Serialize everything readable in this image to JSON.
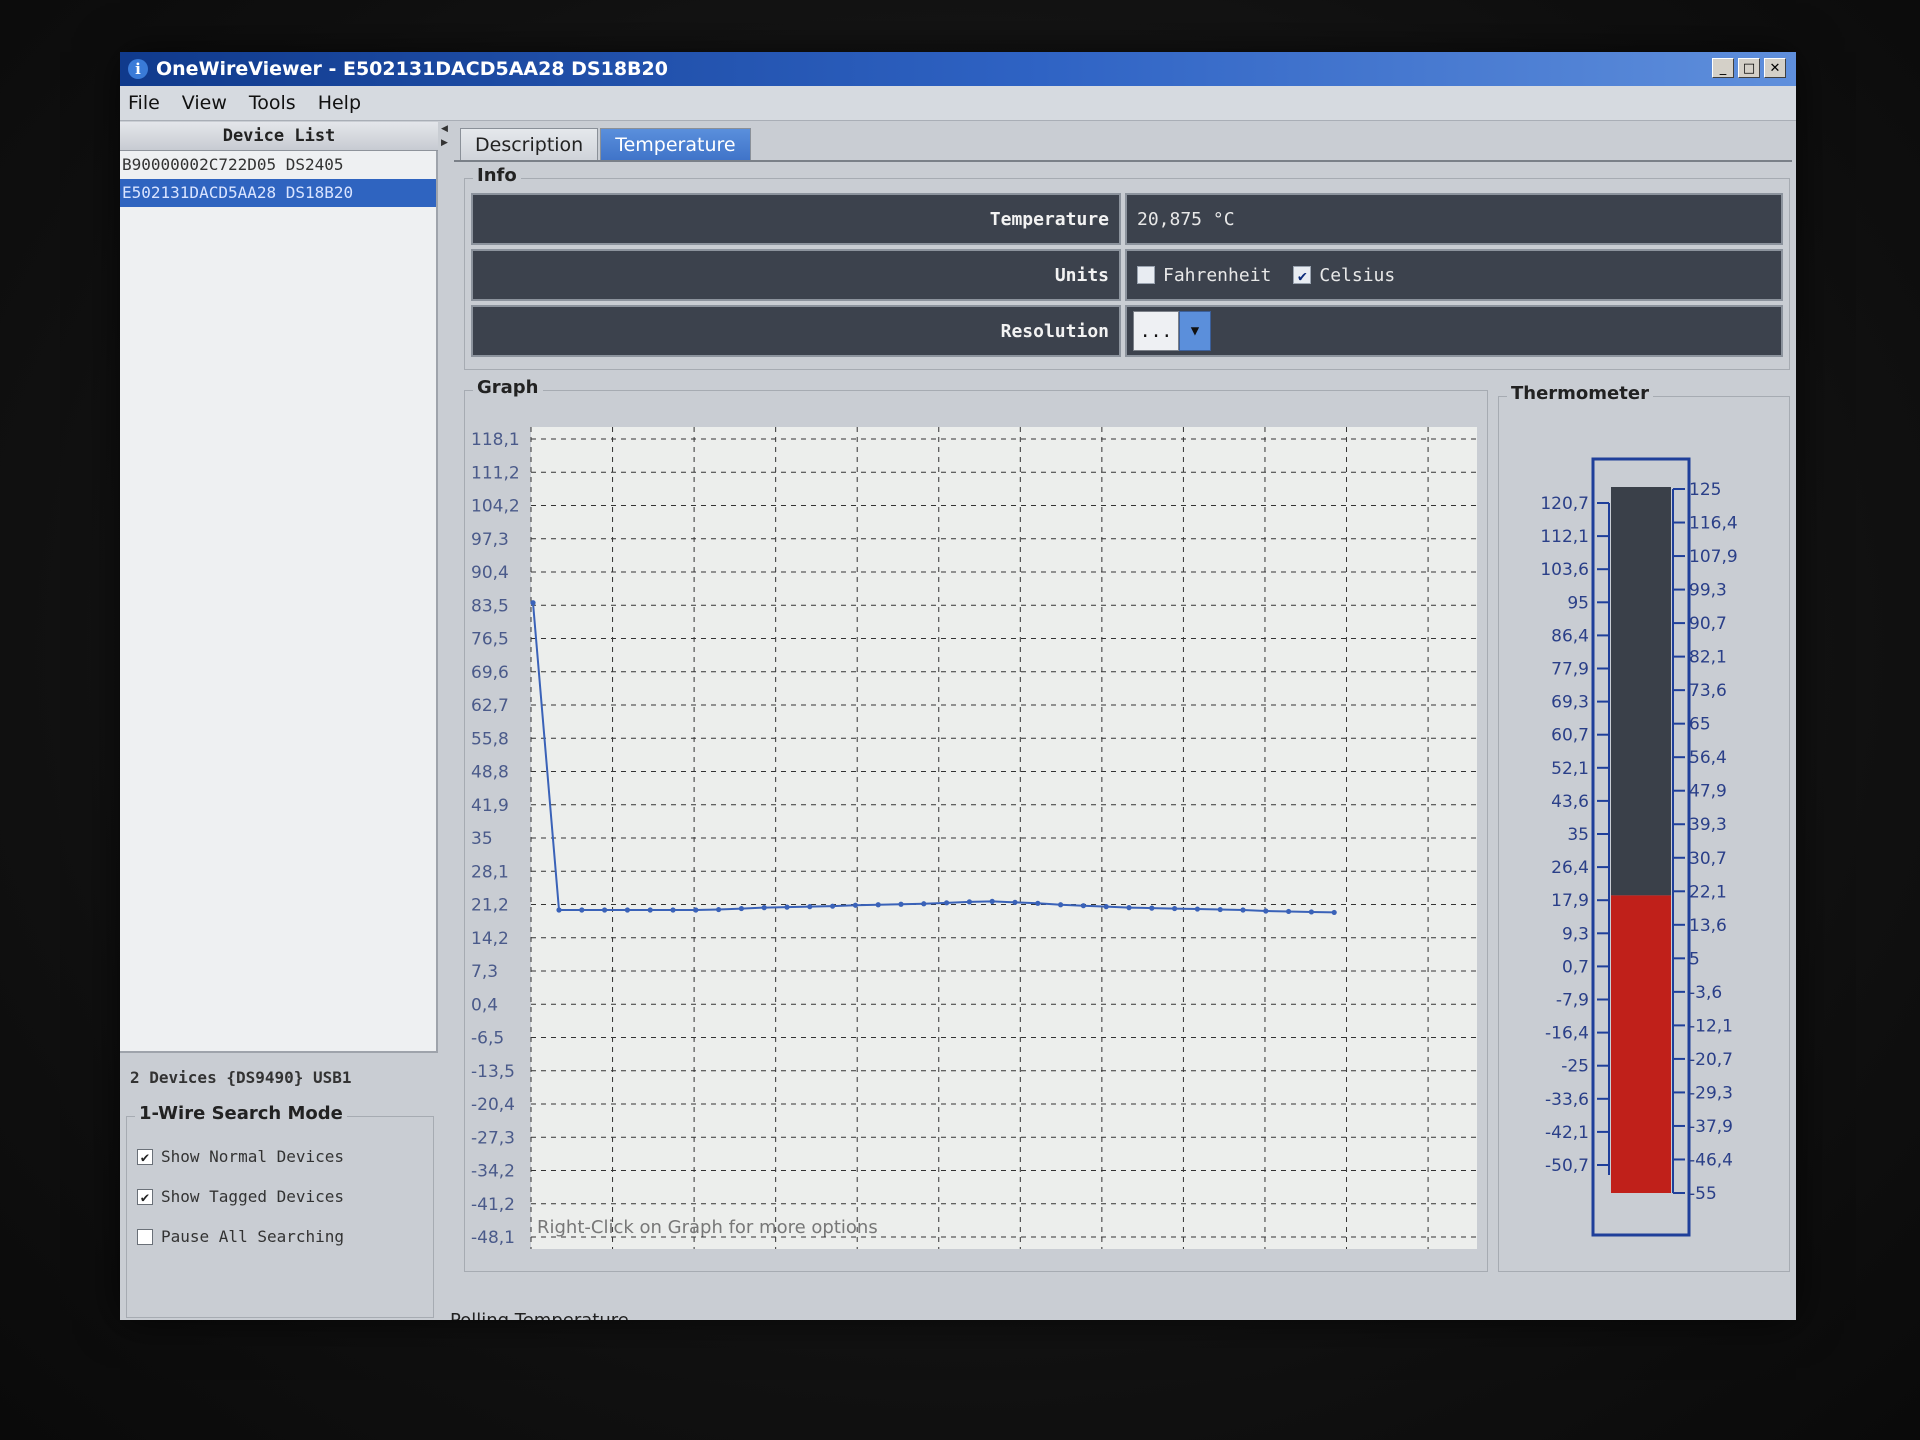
{
  "window": {
    "title": "OneWireViewer - E502131DACD5AA28 DS18B20",
    "title_icon": "i",
    "minimize": "_",
    "maximize": "□",
    "close": "✕"
  },
  "menu": [
    "File",
    "View",
    "Tools",
    "Help"
  ],
  "device_list": {
    "header": "Device List",
    "items": [
      {
        "label": "B90000002C722D05 DS2405",
        "selected": false
      },
      {
        "label": "E502131DACD5AA28 DS18B20",
        "selected": true
      }
    ],
    "adapter_info": "2 Devices  {DS9490} USB1"
  },
  "search_mode": {
    "legend": "1-Wire Search Mode",
    "options": [
      {
        "label": "Show Normal Devices",
        "checked": true
      },
      {
        "label": "Show Tagged Devices",
        "checked": true
      },
      {
        "label": "Pause All Searching",
        "checked": false
      }
    ]
  },
  "tabs": [
    {
      "label": "Description",
      "active": false
    },
    {
      "label": "Temperature",
      "active": true
    }
  ],
  "info": {
    "legend": "Info",
    "temperature_label": "Temperature",
    "temperature_value": "20,875 °C",
    "units_label": "Units",
    "fahrenheit_label": "Fahrenheit",
    "fahrenheit_checked": false,
    "celsius_label": "Celsius",
    "celsius_checked": true,
    "resolution_label": "Resolution",
    "resolution_value": "..."
  },
  "graph": {
    "legend": "Graph",
    "hint": "Right-Click on Graph for more options"
  },
  "thermometer": {
    "legend": "Thermometer",
    "left_ticks": [
      "120,7",
      "112,1",
      "103,6",
      "95",
      "86,4",
      "77,9",
      "69,3",
      "60,7",
      "52,1",
      "43,6",
      "35",
      "26,4",
      "17,9",
      "9,3",
      "0,7",
      "-7,9",
      "-16,4",
      "-25",
      "-33,6",
      "-42,1",
      "-50,7"
    ],
    "right_ticks": [
      "125",
      "116,4",
      "107,9",
      "99,3",
      "90,7",
      "82,1",
      "73,6",
      "65",
      "56,4",
      "47,9",
      "39,3",
      "30,7",
      "22,1",
      "13,6",
      "5",
      "-3,6",
      "-12,1",
      "-20,7",
      "-29,3",
      "-37,9",
      "-46,4",
      "-55"
    ],
    "min": -55,
    "max": 125,
    "value": 20.875,
    "fill_color": "#c0201a",
    "empty_color": "#3a4049"
  },
  "status": "Polling Temperature...",
  "chart_data": {
    "type": "line",
    "title": "",
    "xlabel": "",
    "ylabel": "",
    "ylim": [
      -48.1,
      118.1
    ],
    "y_ticks": [
      "118,1",
      "111,2",
      "104,2",
      "97,3",
      "90,4",
      "83,5",
      "76,5",
      "69,6",
      "62,7",
      "55,8",
      "48,8",
      "41,9",
      "35",
      "28,1",
      "21,2",
      "14,2",
      "7,3",
      "0,4",
      "-6,5",
      "-13,5",
      "-20,4",
      "-27,3",
      "-34,2",
      "-41,2",
      "-48,1"
    ],
    "grid": true,
    "line_color": "#3a62b8",
    "series": [
      {
        "values": [
          84,
          20,
          20,
          20,
          20,
          20,
          20,
          20,
          20.1,
          20.3,
          20.5,
          20.6,
          20.7,
          20.8,
          21.0,
          21.1,
          21.2,
          21.3,
          21.5,
          21.7,
          21.8,
          21.6,
          21.4,
          21.1,
          20.9,
          20.7,
          20.5,
          20.4,
          20.3,
          20.2,
          20.1,
          20.0,
          19.8,
          19.7,
          19.6,
          19.5
        ]
      }
    ]
  }
}
